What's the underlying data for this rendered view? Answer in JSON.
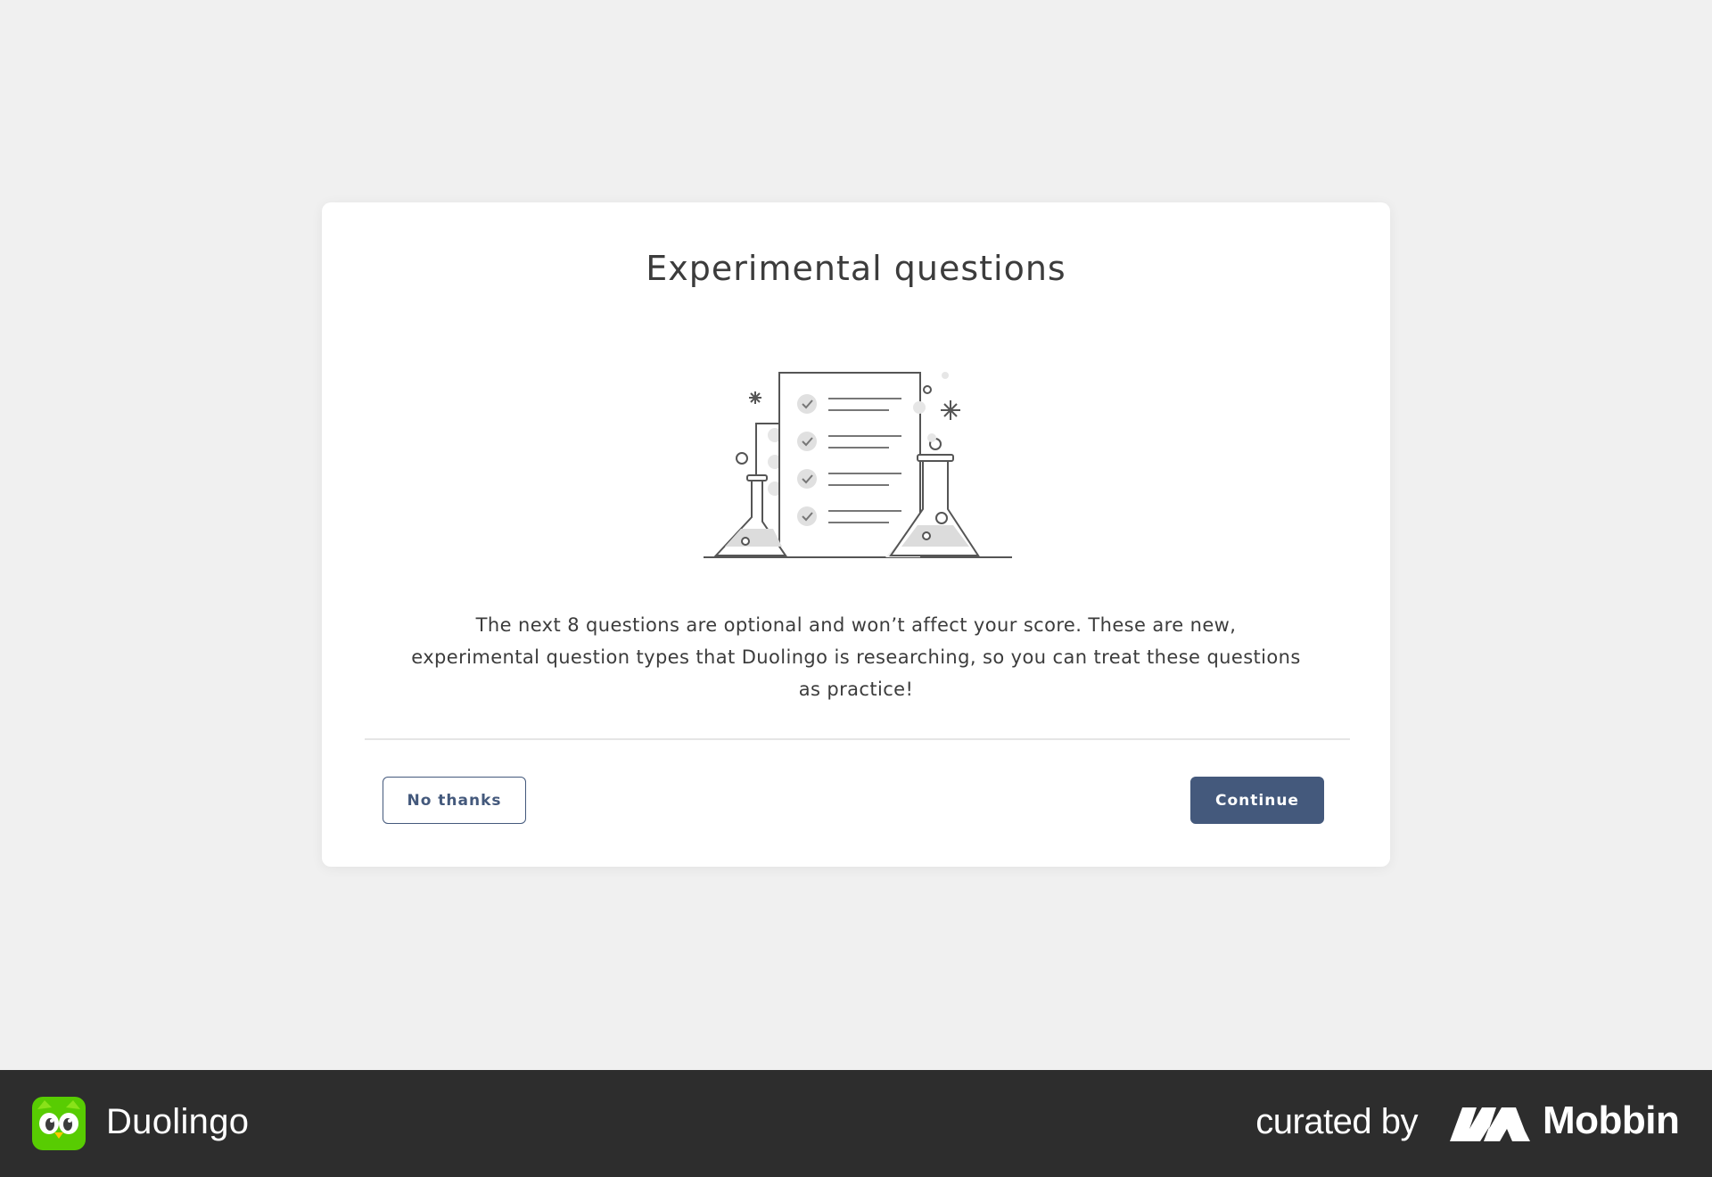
{
  "dialog": {
    "title": "Experimental questions",
    "body": "The next 8 questions are optional and won’t affect your score. These are new, experimental question types that Duolingo is researching, so you can treat these questions as practice!",
    "illustration_icon": "lab-flasks-checklist-icon",
    "secondary_label": "No thanks",
    "primary_label": "Continue"
  },
  "footer": {
    "brand_name": "Duolingo",
    "brand_icon": "duolingo-owl-icon",
    "curated_label": "curated by",
    "curator_name": "Mobbin",
    "curator_icon": "mobbin-logo-icon"
  },
  "colors": {
    "page_bg": "#f0f0f0",
    "card_bg": "#ffffff",
    "primary": "#44597c",
    "text": "#3c3c3c",
    "footer_bg": "#2d2d2d",
    "duolingo_green": "#58cc02"
  }
}
